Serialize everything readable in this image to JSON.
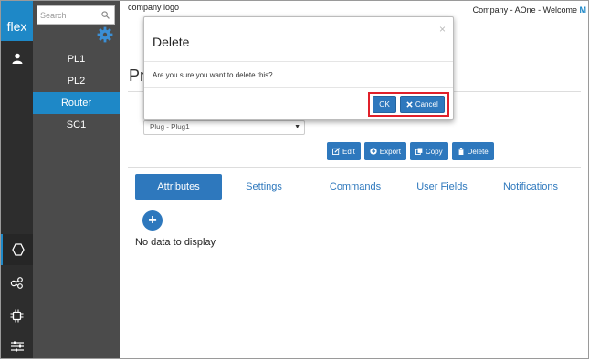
{
  "rail": {
    "brand": "flex",
    "items": [
      {
        "icon": "user-icon"
      },
      {
        "icon": "hexagon-icon"
      },
      {
        "icon": "network-nodes-icon"
      },
      {
        "icon": "chip-icon"
      },
      {
        "icon": "sliders-icon"
      }
    ]
  },
  "sidebar": {
    "search_placeholder": "Search",
    "items": [
      {
        "label": "PL1"
      },
      {
        "label": "PL2"
      },
      {
        "label": "Router",
        "active": true
      },
      {
        "label": "SC1"
      }
    ]
  },
  "header": {
    "logo_text": "company logo",
    "welcome": "Company - AOne - Welcome",
    "welcome_user": "M"
  },
  "page": {
    "title_partial": "Pr",
    "select_value": "Plug - Plug1",
    "actions": [
      {
        "label": "Edit"
      },
      {
        "label": "Export"
      },
      {
        "label": "Copy"
      },
      {
        "label": "Delete"
      }
    ],
    "tabs": [
      {
        "label": "Attributes",
        "active": true
      },
      {
        "label": "Settings"
      },
      {
        "label": "Commands"
      },
      {
        "label": "User Fields"
      },
      {
        "label": "Notifications"
      }
    ],
    "empty_text": "No data to display"
  },
  "modal": {
    "title": "Delete",
    "close": "×",
    "message": "Are you sure you want to delete this?",
    "ok_label": "OK",
    "cancel_label": "Cancel"
  },
  "colors": {
    "accent": "#2e78bd",
    "highlight": "#e0202a",
    "rail_bg": "#2d2d2d",
    "sidebar_bg": "#4b4b4b"
  }
}
